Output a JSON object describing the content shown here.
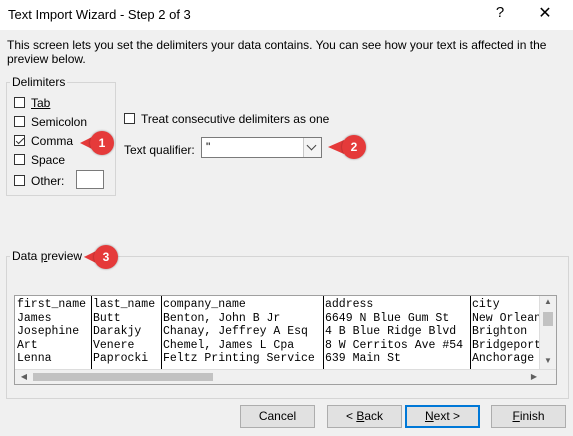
{
  "window": {
    "title": "Text Import Wizard - Step 2 of 3",
    "help_glyph": "?",
    "close_glyph": "✕"
  },
  "description": "This screen lets you set the delimiters your data contains.  You can see how your text is affected in the preview below.",
  "delimiters": {
    "group_label": "Delimiters",
    "tab": {
      "label": "Tab",
      "checked": false
    },
    "semicolon": {
      "label": "Semicolon",
      "checked": false
    },
    "comma": {
      "label": "Comma",
      "checked": true
    },
    "space": {
      "label": "Space",
      "checked": false
    },
    "other": {
      "label": "Other:",
      "checked": false,
      "value": ""
    }
  },
  "consecutive": {
    "label": "Treat consecutive delimiters as one",
    "checked": false
  },
  "qualifier": {
    "label": "Text qualifier:",
    "value": "\""
  },
  "callouts": [
    "1",
    "2",
    "3"
  ],
  "preview": {
    "group_label": "Data preview",
    "rows": [
      [
        "first_name",
        "last_name",
        "company_name",
        "address",
        "city"
      ],
      [
        "James",
        "Butt",
        "Benton, John B Jr",
        "6649 N Blue Gum St",
        "New Orlean"
      ],
      [
        "Josephine",
        "Darakjy",
        "Chanay, Jeffrey A Esq",
        "4 B Blue Ridge Blvd",
        "Brighton"
      ],
      [
        "Art",
        "Venere",
        "Chemel, James L Cpa",
        "8 W Cerritos Ave #54",
        "Bridgeport"
      ],
      [
        "Lenna",
        "Paprocki",
        "Feltz Printing Service",
        "639 Main St",
        "Anchorage"
      ]
    ]
  },
  "buttons": {
    "cancel": "Cancel",
    "back": "< Back",
    "next": "Next >",
    "finish": "Finish"
  },
  "colors": {
    "accent": "#0078d7",
    "callout": "#e53a3a"
  }
}
